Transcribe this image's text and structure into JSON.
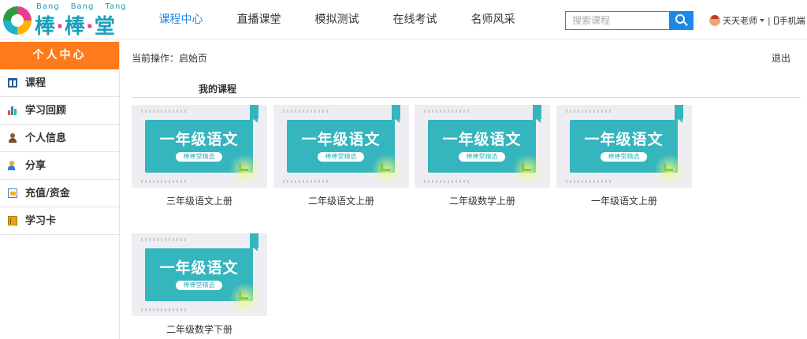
{
  "brand": {
    "pinyin": [
      "Bang",
      "Bang",
      "Tang"
    ],
    "name_parts": [
      "棒",
      "·",
      "棒",
      "·",
      "堂"
    ]
  },
  "nav": {
    "items": [
      {
        "label": "课程中心",
        "active": true
      },
      {
        "label": "直播课堂",
        "active": false
      },
      {
        "label": "模拟测试",
        "active": false
      },
      {
        "label": "在线考试",
        "active": false
      },
      {
        "label": "名师风采",
        "active": false
      }
    ]
  },
  "search": {
    "placeholder": "搜索课程",
    "value": ""
  },
  "user": {
    "name": "天天老师",
    "separator": "|",
    "mobile_label": "手机端"
  },
  "sidebar": {
    "title": "个人中心",
    "items": [
      {
        "label": "课程",
        "icon": "book-icon"
      },
      {
        "label": "学习回顾",
        "icon": "bar-chart-icon"
      },
      {
        "label": "个人信息",
        "icon": "person-icon"
      },
      {
        "label": "分享",
        "icon": "share-users-icon"
      },
      {
        "label": "充值/资金",
        "icon": "payment-icon"
      },
      {
        "label": "学习卡",
        "icon": "study-card-icon"
      }
    ]
  },
  "main": {
    "breadcrumb": "当前操作：启始页",
    "logout_label": "退出",
    "section_title": "我的课程",
    "courses": [
      {
        "thumb_title": "一年级语文",
        "thumb_tag": "棒棒堂精选",
        "name": "三年级语文上册"
      },
      {
        "thumb_title": "一年级语文",
        "thumb_tag": "棒棒堂精选",
        "name": "二年级语文上册"
      },
      {
        "thumb_title": "一年级语文",
        "thumb_tag": "棒棒堂精选",
        "name": "二年级数学上册"
      },
      {
        "thumb_title": "一年级语文",
        "thumb_tag": "棒棒堂精选",
        "name": "一年级语文上册"
      },
      {
        "thumb_title": "一年级语文",
        "thumb_tag": "棒棒堂精选",
        "name": "二年级数学下册"
      }
    ]
  },
  "colors": {
    "accent_blue": "#1e88e5",
    "sidebar_header": "#ff7a1a",
    "thumb_teal": "#35b5be",
    "brand_teal": "#1aa0b8",
    "brand_pink": "#e83e8c"
  }
}
